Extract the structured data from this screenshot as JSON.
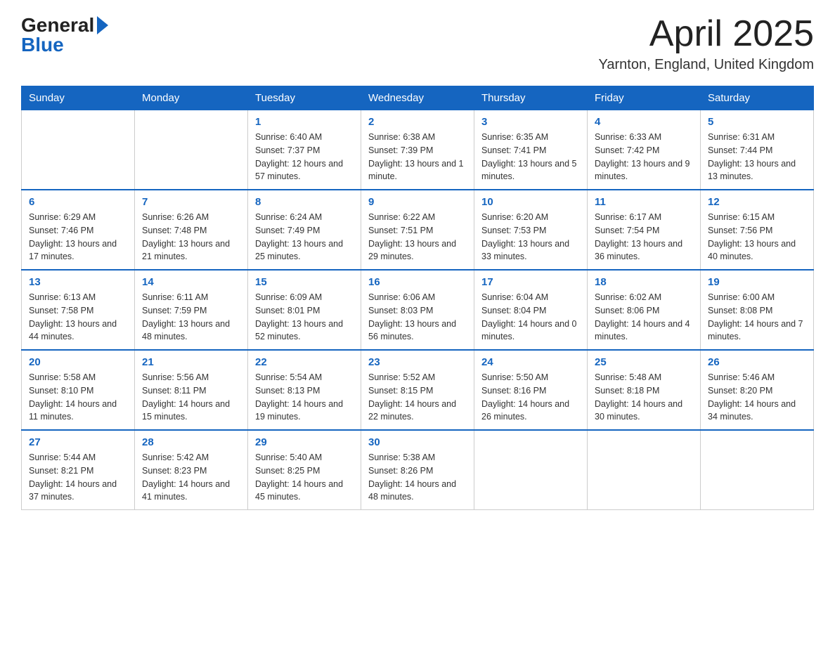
{
  "header": {
    "logo_general": "General",
    "logo_blue": "Blue",
    "month_title": "April 2025",
    "location": "Yarnton, England, United Kingdom"
  },
  "weekdays": [
    "Sunday",
    "Monday",
    "Tuesday",
    "Wednesday",
    "Thursday",
    "Friday",
    "Saturday"
  ],
  "weeks": [
    [
      {
        "day": "",
        "sunrise": "",
        "sunset": "",
        "daylight": ""
      },
      {
        "day": "",
        "sunrise": "",
        "sunset": "",
        "daylight": ""
      },
      {
        "day": "1",
        "sunrise": "Sunrise: 6:40 AM",
        "sunset": "Sunset: 7:37 PM",
        "daylight": "Daylight: 12 hours and 57 minutes."
      },
      {
        "day": "2",
        "sunrise": "Sunrise: 6:38 AM",
        "sunset": "Sunset: 7:39 PM",
        "daylight": "Daylight: 13 hours and 1 minute."
      },
      {
        "day": "3",
        "sunrise": "Sunrise: 6:35 AM",
        "sunset": "Sunset: 7:41 PM",
        "daylight": "Daylight: 13 hours and 5 minutes."
      },
      {
        "day": "4",
        "sunrise": "Sunrise: 6:33 AM",
        "sunset": "Sunset: 7:42 PM",
        "daylight": "Daylight: 13 hours and 9 minutes."
      },
      {
        "day": "5",
        "sunrise": "Sunrise: 6:31 AM",
        "sunset": "Sunset: 7:44 PM",
        "daylight": "Daylight: 13 hours and 13 minutes."
      }
    ],
    [
      {
        "day": "6",
        "sunrise": "Sunrise: 6:29 AM",
        "sunset": "Sunset: 7:46 PM",
        "daylight": "Daylight: 13 hours and 17 minutes."
      },
      {
        "day": "7",
        "sunrise": "Sunrise: 6:26 AM",
        "sunset": "Sunset: 7:48 PM",
        "daylight": "Daylight: 13 hours and 21 minutes."
      },
      {
        "day": "8",
        "sunrise": "Sunrise: 6:24 AM",
        "sunset": "Sunset: 7:49 PM",
        "daylight": "Daylight: 13 hours and 25 minutes."
      },
      {
        "day": "9",
        "sunrise": "Sunrise: 6:22 AM",
        "sunset": "Sunset: 7:51 PM",
        "daylight": "Daylight: 13 hours and 29 minutes."
      },
      {
        "day": "10",
        "sunrise": "Sunrise: 6:20 AM",
        "sunset": "Sunset: 7:53 PM",
        "daylight": "Daylight: 13 hours and 33 minutes."
      },
      {
        "day": "11",
        "sunrise": "Sunrise: 6:17 AM",
        "sunset": "Sunset: 7:54 PM",
        "daylight": "Daylight: 13 hours and 36 minutes."
      },
      {
        "day": "12",
        "sunrise": "Sunrise: 6:15 AM",
        "sunset": "Sunset: 7:56 PM",
        "daylight": "Daylight: 13 hours and 40 minutes."
      }
    ],
    [
      {
        "day": "13",
        "sunrise": "Sunrise: 6:13 AM",
        "sunset": "Sunset: 7:58 PM",
        "daylight": "Daylight: 13 hours and 44 minutes."
      },
      {
        "day": "14",
        "sunrise": "Sunrise: 6:11 AM",
        "sunset": "Sunset: 7:59 PM",
        "daylight": "Daylight: 13 hours and 48 minutes."
      },
      {
        "day": "15",
        "sunrise": "Sunrise: 6:09 AM",
        "sunset": "Sunset: 8:01 PM",
        "daylight": "Daylight: 13 hours and 52 minutes."
      },
      {
        "day": "16",
        "sunrise": "Sunrise: 6:06 AM",
        "sunset": "Sunset: 8:03 PM",
        "daylight": "Daylight: 13 hours and 56 minutes."
      },
      {
        "day": "17",
        "sunrise": "Sunrise: 6:04 AM",
        "sunset": "Sunset: 8:04 PM",
        "daylight": "Daylight: 14 hours and 0 minutes."
      },
      {
        "day": "18",
        "sunrise": "Sunrise: 6:02 AM",
        "sunset": "Sunset: 8:06 PM",
        "daylight": "Daylight: 14 hours and 4 minutes."
      },
      {
        "day": "19",
        "sunrise": "Sunrise: 6:00 AM",
        "sunset": "Sunset: 8:08 PM",
        "daylight": "Daylight: 14 hours and 7 minutes."
      }
    ],
    [
      {
        "day": "20",
        "sunrise": "Sunrise: 5:58 AM",
        "sunset": "Sunset: 8:10 PM",
        "daylight": "Daylight: 14 hours and 11 minutes."
      },
      {
        "day": "21",
        "sunrise": "Sunrise: 5:56 AM",
        "sunset": "Sunset: 8:11 PM",
        "daylight": "Daylight: 14 hours and 15 minutes."
      },
      {
        "day": "22",
        "sunrise": "Sunrise: 5:54 AM",
        "sunset": "Sunset: 8:13 PM",
        "daylight": "Daylight: 14 hours and 19 minutes."
      },
      {
        "day": "23",
        "sunrise": "Sunrise: 5:52 AM",
        "sunset": "Sunset: 8:15 PM",
        "daylight": "Daylight: 14 hours and 22 minutes."
      },
      {
        "day": "24",
        "sunrise": "Sunrise: 5:50 AM",
        "sunset": "Sunset: 8:16 PM",
        "daylight": "Daylight: 14 hours and 26 minutes."
      },
      {
        "day": "25",
        "sunrise": "Sunrise: 5:48 AM",
        "sunset": "Sunset: 8:18 PM",
        "daylight": "Daylight: 14 hours and 30 minutes."
      },
      {
        "day": "26",
        "sunrise": "Sunrise: 5:46 AM",
        "sunset": "Sunset: 8:20 PM",
        "daylight": "Daylight: 14 hours and 34 minutes."
      }
    ],
    [
      {
        "day": "27",
        "sunrise": "Sunrise: 5:44 AM",
        "sunset": "Sunset: 8:21 PM",
        "daylight": "Daylight: 14 hours and 37 minutes."
      },
      {
        "day": "28",
        "sunrise": "Sunrise: 5:42 AM",
        "sunset": "Sunset: 8:23 PM",
        "daylight": "Daylight: 14 hours and 41 minutes."
      },
      {
        "day": "29",
        "sunrise": "Sunrise: 5:40 AM",
        "sunset": "Sunset: 8:25 PM",
        "daylight": "Daylight: 14 hours and 45 minutes."
      },
      {
        "day": "30",
        "sunrise": "Sunrise: 5:38 AM",
        "sunset": "Sunset: 8:26 PM",
        "daylight": "Daylight: 14 hours and 48 minutes."
      },
      {
        "day": "",
        "sunrise": "",
        "sunset": "",
        "daylight": ""
      },
      {
        "day": "",
        "sunrise": "",
        "sunset": "",
        "daylight": ""
      },
      {
        "day": "",
        "sunrise": "",
        "sunset": "",
        "daylight": ""
      }
    ]
  ]
}
